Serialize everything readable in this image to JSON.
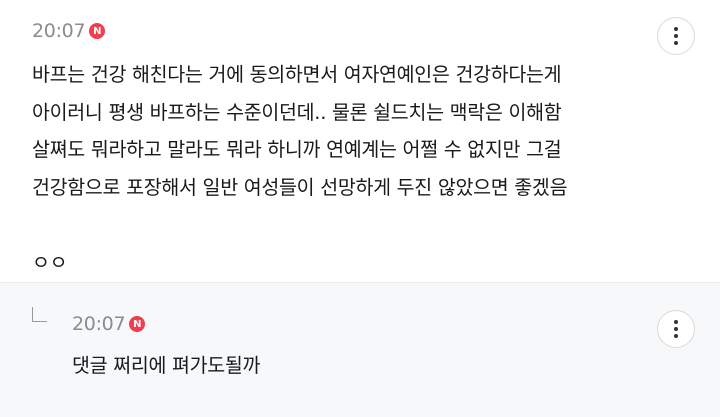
{
  "comment": {
    "time": "20:07",
    "new_badge": "N",
    "lines": [
      "바프는 건강 해친다는 거에 동의하면서 여자연예인은 건강하다는게",
      "아이러니 평생 바프하는 수준이던데.. 물론 쉴드치는 맥락은 이해함",
      "살쪄도 뭐라하고 말라도 뭐라 하니까 연예계는 어쩔 수 없지만 그걸",
      "건강함으로 포장해서 일반 여성들이 선망하게 두진 않았으면 좋겠음",
      "",
      "ㅇㅇ"
    ],
    "more_icon": "more-vertical-icon"
  },
  "reply": {
    "time": "20:07",
    "new_badge": "N",
    "text": "댓글 쩌리에 펴가도될까",
    "reply_icon": "reply-arrow-icon",
    "more_icon": "more-vertical-icon"
  },
  "colors": {
    "badge": "#f23d4f",
    "time": "#8c8c8c",
    "reply_bg": "#f7f8fa"
  }
}
